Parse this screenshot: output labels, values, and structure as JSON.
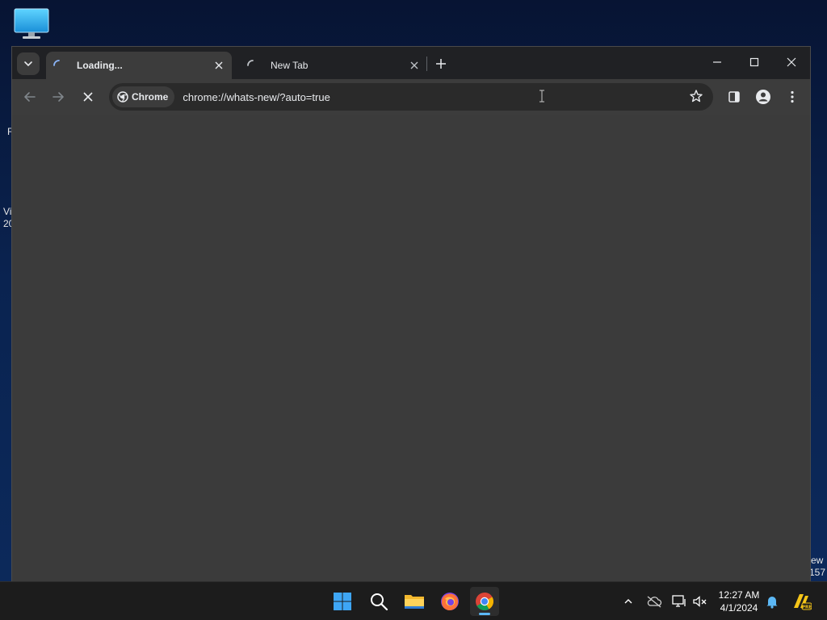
{
  "desktop": {
    "left_edge_texts": [
      "R",
      "Vi",
      "20"
    ],
    "right_edge_texts": [
      "ew",
      "157"
    ]
  },
  "browser": {
    "tabs": [
      {
        "title": "Loading...",
        "active": true
      },
      {
        "title": "New Tab",
        "active": false
      }
    ],
    "chip_label": "Chrome",
    "url": "chrome://whats-new/?auto=true"
  },
  "taskbar": {
    "apps": [
      "windows-start",
      "search",
      "file-explorer",
      "firefox",
      "chrome"
    ],
    "clock": {
      "time": "12:27 AM",
      "date": "4/1/2024"
    }
  },
  "colors": {
    "tabstrip": "#202124",
    "toolbar": "#3c3c3c",
    "content": "#3b3b3b",
    "taskbar": "#1c1c1c",
    "accent": "#5cb8f5"
  }
}
